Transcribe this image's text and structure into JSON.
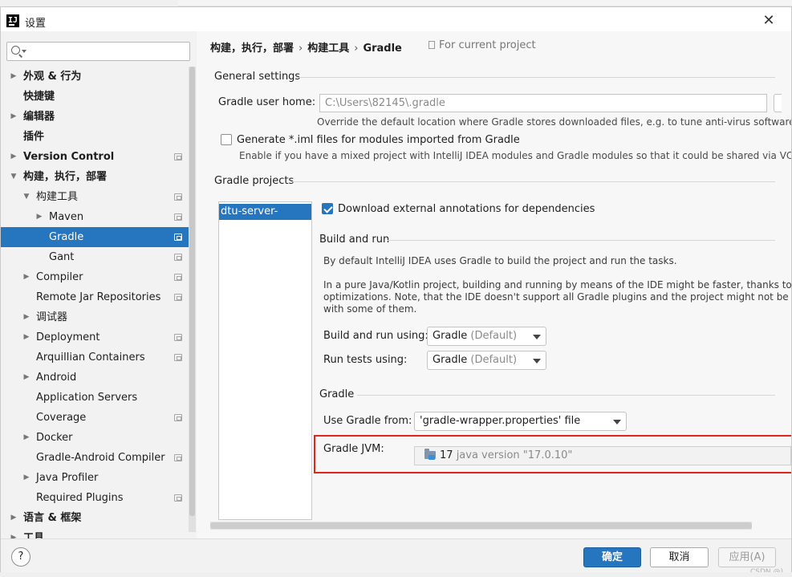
{
  "window": {
    "title": "设置"
  },
  "search": {
    "placeholder": ""
  },
  "sidebar": {
    "items": [
      {
        "label": "外观 & 行为",
        "expandable": true,
        "bold": true,
        "project_icon": false
      },
      {
        "label": "快捷键",
        "expandable": false,
        "bold": true,
        "project_icon": false
      },
      {
        "label": "编辑器",
        "expandable": true,
        "bold": true,
        "project_icon": false
      },
      {
        "label": "插件",
        "expandable": false,
        "bold": true,
        "project_icon": false
      },
      {
        "label": "Version Control",
        "expandable": true,
        "bold": true,
        "project_icon": true
      },
      {
        "label": "构建，执行，部署",
        "expandable": true,
        "expanded": true,
        "bold": true,
        "project_icon": false
      },
      {
        "label": "构建工具",
        "expandable": true,
        "expanded": true,
        "bold": false,
        "project_icon": true
      },
      {
        "label": "Maven",
        "expandable": true,
        "bold": false,
        "project_icon": true
      },
      {
        "label": "Gradle",
        "expandable": false,
        "bold": false,
        "project_icon": true,
        "selected": true
      },
      {
        "label": "Gant",
        "expandable": false,
        "bold": false,
        "project_icon": true
      },
      {
        "label": "Compiler",
        "expandable": true,
        "bold": false,
        "project_icon": true
      },
      {
        "label": "Remote Jar Repositories",
        "expandable": false,
        "bold": false,
        "project_icon": true
      },
      {
        "label": "调试器",
        "expandable": true,
        "bold": false,
        "project_icon": false
      },
      {
        "label": "Deployment",
        "expandable": true,
        "bold": false,
        "project_icon": true
      },
      {
        "label": "Arquillian Containers",
        "expandable": false,
        "bold": false,
        "project_icon": true
      },
      {
        "label": "Android",
        "expandable": true,
        "bold": false,
        "project_icon": false
      },
      {
        "label": "Application Servers",
        "expandable": false,
        "bold": false,
        "project_icon": false
      },
      {
        "label": "Coverage",
        "expandable": false,
        "bold": false,
        "project_icon": true
      },
      {
        "label": "Docker",
        "expandable": true,
        "bold": false,
        "project_icon": false
      },
      {
        "label": "Gradle-Android Compiler",
        "expandable": false,
        "bold": false,
        "project_icon": true
      },
      {
        "label": "Java Profiler",
        "expandable": true,
        "bold": false,
        "project_icon": false
      },
      {
        "label": "Required Plugins",
        "expandable": false,
        "bold": false,
        "project_icon": true
      },
      {
        "label": "语言 & 框架",
        "expandable": true,
        "bold": true,
        "project_icon": false
      },
      {
        "label": "工具",
        "expandable": true,
        "bold": true,
        "project_icon": false
      }
    ]
  },
  "breadcrumb": {
    "parts": [
      "构建，执行，部署",
      "构建工具",
      "Gradle"
    ],
    "separator": "›",
    "for_current": "For current project"
  },
  "general": {
    "title": "General settings",
    "user_home_label": "Gradle user home:",
    "user_home_value": "C:\\Users\\82145\\.gradle",
    "user_home_hint": "Override the default location where Gradle stores downloaded files, e.g. to tune anti-virus software on Windo",
    "generate_iml_label": "Generate *.iml files for modules imported from Gradle",
    "generate_iml_hint": "Enable if you have a mixed project with IntelliJ IDEA modules and Gradle modules so that it could be shared via VCS"
  },
  "projects": {
    "title": "Gradle projects",
    "items": [
      "dtu-server-master"
    ]
  },
  "project_settings": {
    "download_annotations_label": "Download external annotations for dependencies",
    "build_run_title": "Build and run",
    "build_run_hint_1": "By default IntelliJ IDEA uses Gradle to build the project and run the tasks.",
    "build_run_hint_2": "In a pure Java/Kotlin project, building and running by means of the IDE might be faster, thanks to",
    "build_run_hint_3": "optimizations. Note, that the IDE doesn't support all Gradle plugins and the project might not be built corre",
    "build_run_hint_4": "with some of them.",
    "build_run_using_label": "Build and run using:",
    "build_run_using_value": "Gradle",
    "build_run_using_suffix": "(Default)",
    "run_tests_label": "Run tests using:",
    "run_tests_value": "Gradle",
    "run_tests_suffix": "(Default)",
    "gradle_title": "Gradle",
    "use_gradle_from_label": "Use Gradle from:",
    "use_gradle_from_value": "'gradle-wrapper.properties' file",
    "jvm_label": "Gradle JVM:",
    "jvm_version": "17",
    "jvm_detail": "java version \"17.0.10\""
  },
  "footer": {
    "help": "?",
    "ok": "确定",
    "cancel": "取消",
    "apply": "应用(A)",
    "watermark": "CSDN @)"
  },
  "colors": {
    "accent": "#2675bf",
    "highlight_box": "#e1251b"
  }
}
